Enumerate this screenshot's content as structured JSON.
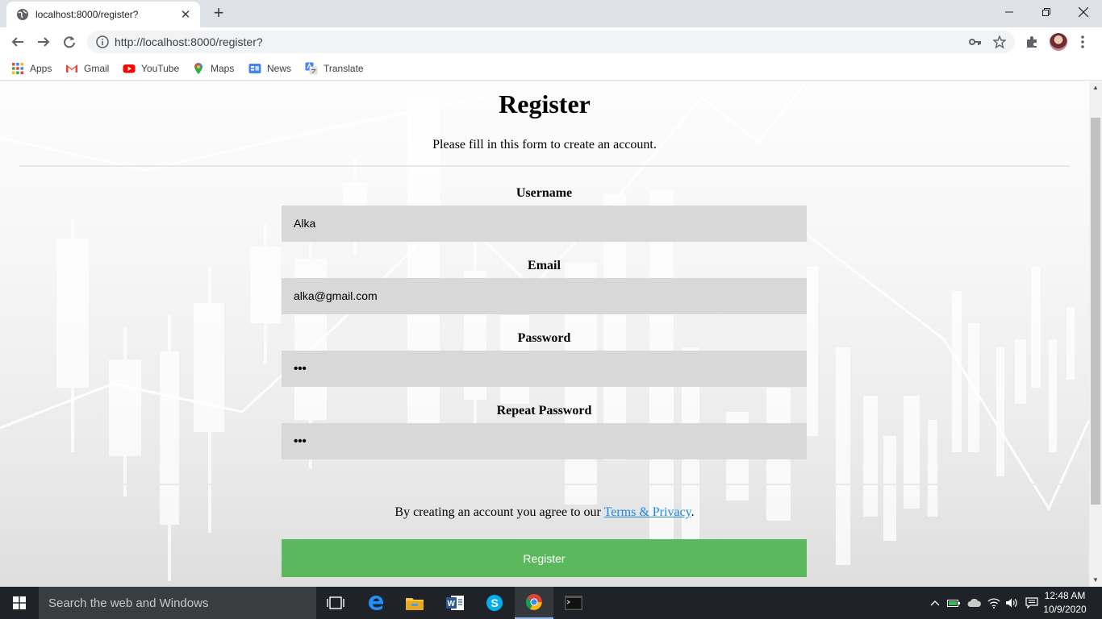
{
  "browser": {
    "tab_title": "localhost:8000/register?",
    "new_tab_label": "+",
    "url": "http://localhost:8000/register?",
    "bookmarks": [
      {
        "label": "Apps",
        "icon": "apps-grid-icon"
      },
      {
        "label": "Gmail",
        "icon": "gmail-icon"
      },
      {
        "label": "YouTube",
        "icon": "youtube-icon"
      },
      {
        "label": "Maps",
        "icon": "maps-icon"
      },
      {
        "label": "News",
        "icon": "news-icon"
      },
      {
        "label": "Translate",
        "icon": "translate-icon"
      }
    ]
  },
  "form": {
    "title": "Register",
    "subtitle": "Please fill in this form to create an account.",
    "fields": [
      {
        "label": "Username",
        "value": "Alka",
        "type": "text"
      },
      {
        "label": "Email",
        "value": "alka@gmail.com",
        "type": "email"
      },
      {
        "label": "Password",
        "value": "•••",
        "type": "password"
      },
      {
        "label": "Repeat Password",
        "value": "•••",
        "type": "password"
      }
    ],
    "terms_prefix": "By creating an account you agree to our ",
    "terms_link": "Terms & Privacy",
    "terms_suffix": ".",
    "submit_label": "Register"
  },
  "taskbar": {
    "search_placeholder": "Search the web and Windows",
    "time": "12:48 AM",
    "date": "10/9/2020"
  },
  "colors": {
    "submit_bg": "#5cb85c",
    "input_bg": "#d8d8d8",
    "link": "#1e88e5"
  }
}
